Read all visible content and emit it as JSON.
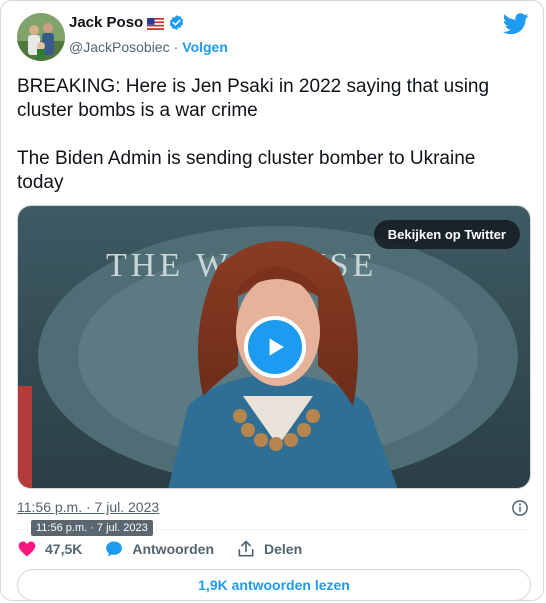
{
  "author": {
    "name": "Jack Poso",
    "handle": "@JackPosobiec",
    "separator": "·",
    "follow_label": "Volgen"
  },
  "tweet": {
    "text": "BREAKING: Here is Jen Psaki in 2022 saying that using cluster bombs is a war crime\n\nThe Biden Admin is sending cluster bomber to Ukraine today"
  },
  "media": {
    "watch_label": "Bekijken op Twitter",
    "backdrop_text": "THE W   HOUSE"
  },
  "timestamp": {
    "text": "11:56 p.m. · 7 jul. 2023",
    "tooltip": "11:56 p.m. · 7 jul. 2023"
  },
  "actions": {
    "likes": "47,5K",
    "reply_label": "Antwoorden",
    "share_label": "Delen"
  },
  "read_replies_label": "1,9K antwoorden lezen",
  "colors": {
    "accent": "#1d9bf0",
    "like": "#f91880",
    "muted": "#536471",
    "border": "#cfd9de"
  },
  "icons": [
    "avatar",
    "us-flag-icon",
    "verified-badge-icon",
    "twitter-bird-icon",
    "play-icon",
    "info-icon",
    "heart-icon",
    "reply-icon",
    "share-icon"
  ]
}
